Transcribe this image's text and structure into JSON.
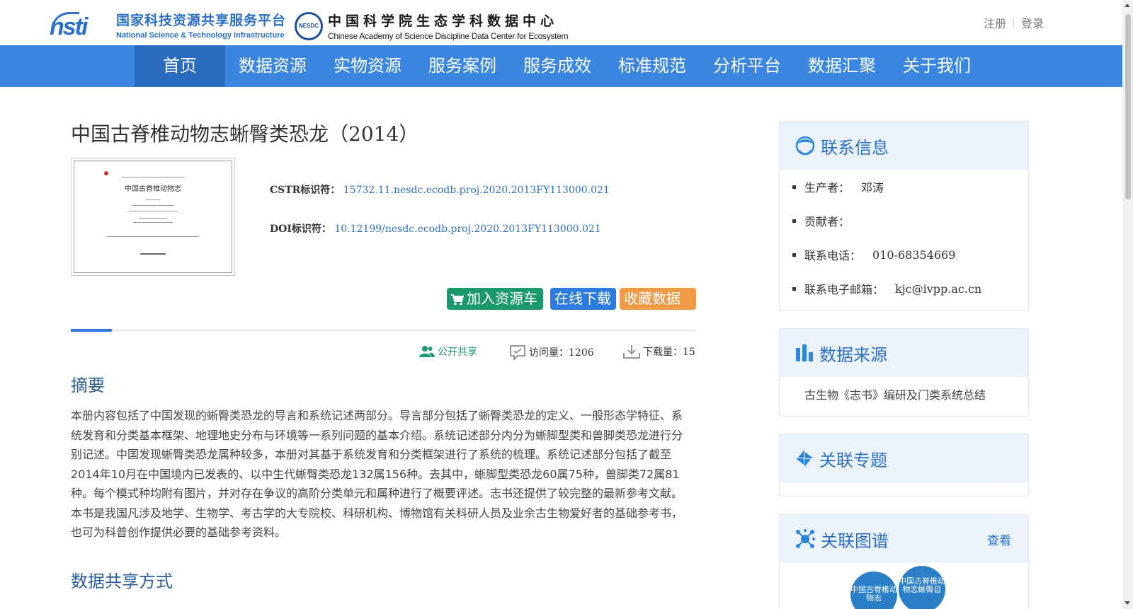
{
  "header": {
    "logo1": {
      "cn": "国家科技资源共享服务平台",
      "en": "National Science & Technology Infrastructure",
      "mark": "nsti"
    },
    "logo2": {
      "cn": "中国科学院生态学科数据中心",
      "en": "Chinese Academy of Science Discipline Data Center for Ecosystem",
      "mark": "NESDC"
    },
    "register": "注册",
    "login": "登录"
  },
  "nav": {
    "items": [
      {
        "label": "首页"
      },
      {
        "label": "数据资源"
      },
      {
        "label": "实物资源"
      },
      {
        "label": "服务案例"
      },
      {
        "label": "服务成效"
      },
      {
        "label": "标准规范"
      },
      {
        "label": "分析平台"
      },
      {
        "label": "数据汇聚"
      },
      {
        "label": "关于我们"
      }
    ],
    "active_index": 0
  },
  "dataset": {
    "title": "中国古脊椎动物志蜥臀类恐龙（2014）",
    "cover_title": "中国古脊椎动物志",
    "cstr_label": "CSTR标识符：",
    "cstr_value": "15732.11.nesdc.ecodb.proj.2020.2013FY113000.021",
    "doi_label": "DOI标识符：",
    "doi_value": "10.12199/nesdc.ecodb.proj.2020.2013FY113000.021"
  },
  "actions": {
    "cart": "加入资源车",
    "download": "在线下载",
    "favorite": "收藏数据集"
  },
  "stats": {
    "share": "公开共享",
    "visits": "访问量：1206",
    "downloads": "下载量：15"
  },
  "abstract": {
    "heading": "摘要",
    "text": "本册内容包括了中国发现的蜥臀类恐龙的导言和系统记述两部分。导言部分包括了蜥臀类恐龙的定义、一般形态学特征、系统发育和分类基本框架、地理地史分布与环境等一系列问题的基本介绍。系统记述部分内分为蜥脚型类和兽脚类恐龙进行分别记述。中国发现蜥臀类恐龙属种较多，本册对其基于系统发育和分类框架进行了系统的梳理。系统记述部分包括了截至2014年10月在中国境内已发表的、以中生代蜥臀类恐龙132属156种。去其中，蜥脚型类恐龙60属75种，兽脚类72属81种。每个模式种均附有图片，并对存在争议的高阶分类单元和属种进行了概要评述。志书还提供了较完整的最新参考文献。 本书是我国凡涉及地学、生物学、考古学的大专院校、科研机构、博物馆有关科研人员及业余古生物爱好者的基础参考书，也可为科普创作提供必要的基础参考资料。"
  },
  "share_section": {
    "heading": "数据共享方式"
  },
  "sidebar": {
    "contact": {
      "heading": "联系信息",
      "producer_label": "生产者：",
      "producer": "邓涛",
      "contributor_label": "贡献者：",
      "phone_label": "联系电话：",
      "phone": "010-68354669",
      "email_label": "联系电子邮箱：",
      "email": "kjc@ivpp.ac.cn"
    },
    "source": {
      "heading": "数据来源",
      "text": "古生物《志书》编研及门类系统总结"
    },
    "topic": {
      "heading": "关联专题"
    },
    "graph": {
      "heading": "关联图谱",
      "more": "查看",
      "nodes": [
        "中国古脊椎动物志",
        "中国古脊椎动物志蜥臀目"
      ]
    }
  },
  "colors": {
    "nav": "#3a86e0",
    "nav_active": "#2b6cc0",
    "cart": "#1a9a6a",
    "download": "#2b7be0",
    "favorite": "#f09a45",
    "heading_blue": "#2a5d99"
  }
}
